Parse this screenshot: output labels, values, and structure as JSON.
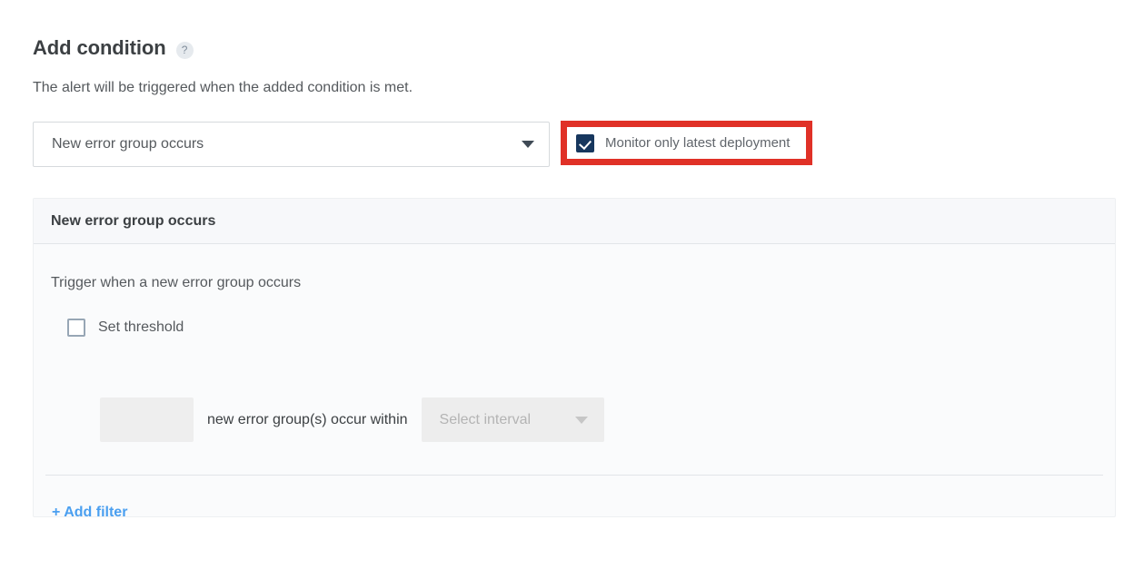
{
  "header": {
    "title": "Add condition",
    "help_icon": "question-mark-icon",
    "subtitle": "The alert will be triggered when the added condition is met."
  },
  "condition_select": {
    "value": "New error group occurs",
    "caret_icon": "chevron-down-icon"
  },
  "latest_deployment": {
    "label": "Monitor only latest deployment",
    "checked": true,
    "annotation_color": "#e03127"
  },
  "panel": {
    "header_title": "New error group occurs",
    "trigger_text": "Trigger when a new error group occurs",
    "set_threshold": {
      "label": "Set threshold",
      "checked": false
    },
    "threshold_value": "",
    "threshold_placeholder": "",
    "interval_text": "new error group(s) occur within",
    "interval_select": {
      "value": "Select interval",
      "caret_icon": "chevron-down-icon",
      "disabled": true
    },
    "add_filter_label": "+ Add filter"
  },
  "colors": {
    "accent_link": "#4a9ff0",
    "checkbox_checked": "#17375e",
    "annotation": "#e03127",
    "panel_bg": "#fafbfc"
  }
}
